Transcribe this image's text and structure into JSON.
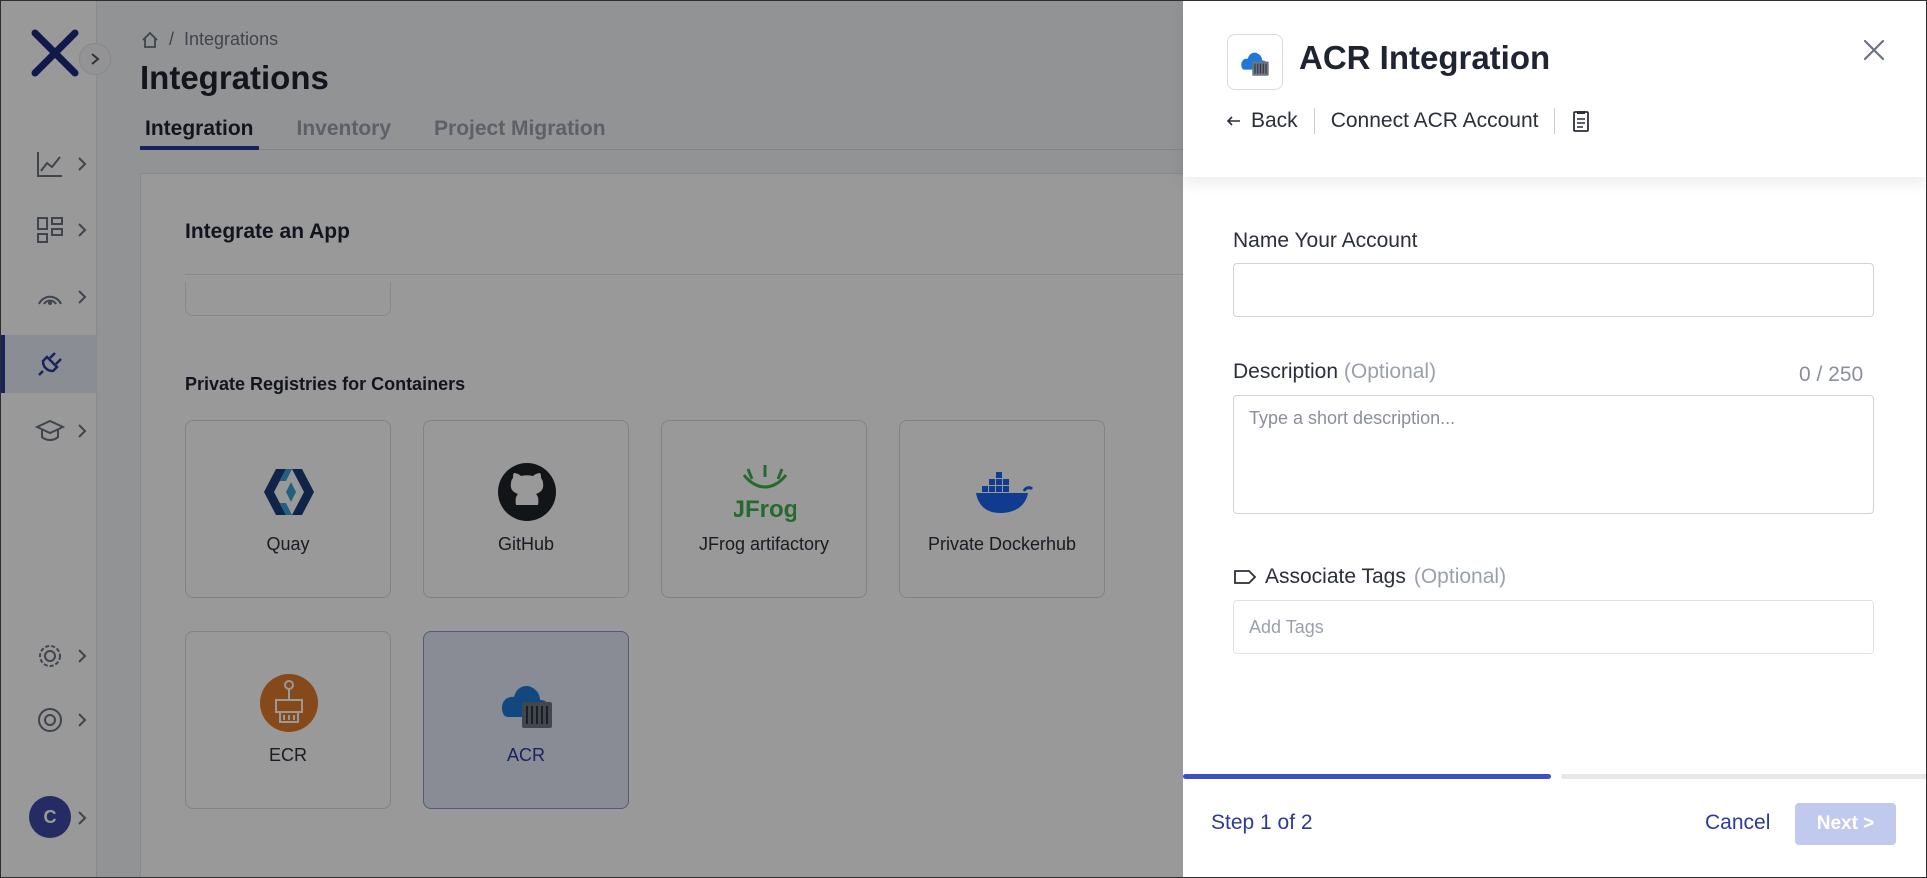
{
  "sidebar": {
    "logo": "x-logo-icon",
    "nav_icons": [
      "chart-line-icon",
      "dashboard-grid-icon",
      "radar-icon",
      "plug-icon",
      "graduation-cap-icon",
      "settings-gear-icon",
      "lifebuoy-icon"
    ],
    "active_item": "plug-icon",
    "avatar_initial": "C"
  },
  "breadcrumb": {
    "home_icon": "home-icon",
    "separator": "/",
    "current": "Integrations"
  },
  "page": {
    "title": "Integrations",
    "tabs": [
      {
        "label": "Integration",
        "active": true
      },
      {
        "label": "Inventory",
        "active": false
      },
      {
        "label": "Project Migration",
        "active": false
      }
    ]
  },
  "integrate": {
    "title": "Integrate an App",
    "private_registries": {
      "title": "Private Registries for Containers",
      "apps": [
        {
          "label": "Quay",
          "icon": "quay-logo-icon"
        },
        {
          "label": "GitHub",
          "icon": "github-logo-icon"
        },
        {
          "label": "JFrog artifactory",
          "icon": "jfrog-logo-icon"
        },
        {
          "label": "Private Dockerhub",
          "icon": "docker-logo-icon"
        },
        {
          "label": "ECR",
          "icon": "ecr-logo-icon"
        },
        {
          "label": "ACR",
          "icon": "acr-logo-icon",
          "selected": true
        }
      ]
    }
  },
  "drawer": {
    "title": "ACR Integration",
    "back_label": "Back",
    "subtitle": "Connect ACR Account",
    "docs_icon": "document-icon",
    "form": {
      "name_label": "Name Your Account",
      "name_value": "",
      "description_label": "Description",
      "description_optional": "(Optional)",
      "description_counter": "0 / 250",
      "description_placeholder": "Type a short description...",
      "tags_label": "Associate Tags",
      "tags_optional": "(Optional)",
      "tags_placeholder": "Add Tags"
    },
    "progress": {
      "current_step": 1,
      "total_steps": 2
    },
    "step_text": "Step 1 of 2",
    "cancel_label": "Cancel",
    "next_label": "Next >"
  },
  "colors": {
    "brand": "#2b3a9b",
    "progress_active": "#3d4fc4",
    "next_disabled": "#c2c9ee"
  }
}
